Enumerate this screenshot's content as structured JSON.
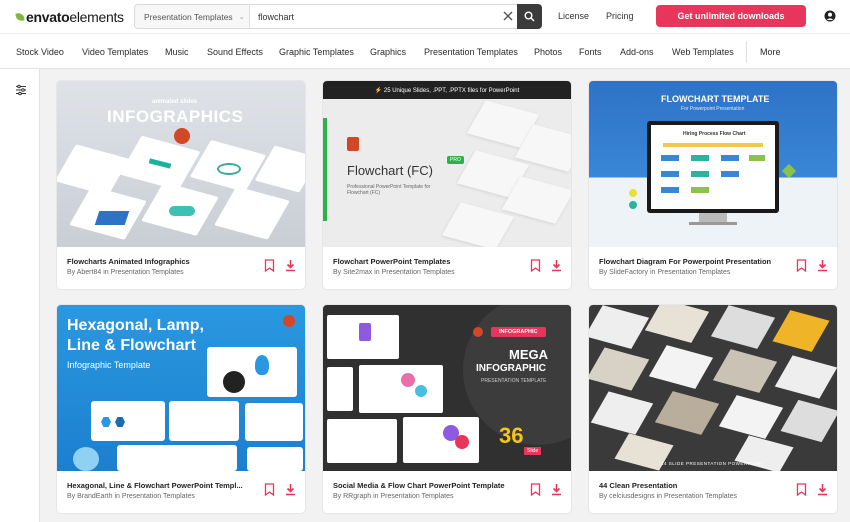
{
  "header": {
    "logo_bold": "envato",
    "logo_light": "elements",
    "search_category": "Presentation Templates",
    "search_value": "flowchart",
    "links": [
      "License",
      "Pricing"
    ],
    "cta": "Get unlimited downloads"
  },
  "nav": {
    "items": [
      "Stock Video",
      "Video Templates",
      "Music",
      "Sound Effects",
      "Graphic Templates",
      "Graphics",
      "Presentation Templates",
      "Photos",
      "Fonts",
      "Add-ons",
      "Web Templates"
    ],
    "more": "More"
  },
  "cards": [
    {
      "title": "Flowcharts Animated Infographics",
      "author": "By Abert84 in Presentation Templates",
      "thumb_top": "animated slides",
      "thumb_main": "INFOGRAPHICS"
    },
    {
      "title": "Flowchart PowerPoint Templates",
      "author": "By Site2max in Presentation Templates",
      "banner": "⚡ 25 Unique Slides, .PPT, .PPTX files for PowerPoint",
      "thumb_main": "Flowchart (FC)",
      "thumb_badge": "PRO",
      "thumb_sub": "Professional PowerPoint Template for Flowchart (FC)"
    },
    {
      "title": "Flowchart Diagram For Powerpoint Presentation",
      "author": "By SlideFactory in Presentation Templates",
      "thumb_main": "FLOWCHART TEMPLATE",
      "thumb_sub": "For Powerpoint Presentation",
      "thumb_screen": "Hiring Process Flow Chart"
    },
    {
      "title": "Hexagonal, Line & Flowchart PowerPoint Templ...",
      "author": "By BrandEarth in Presentation Templates",
      "thumb_l1": "Hexagonal, Lamp,",
      "thumb_l2": "Line & Flowchart",
      "thumb_l3": "Infographic Template"
    },
    {
      "title": "Social Media & Flow Chart PowerPoint Template",
      "author": "By RRgraph in Presentation Templates",
      "thumb_pill": "INFOGRAPHIC",
      "thumb_l1": "MEGA",
      "thumb_l2": "INFOGRAPHIC",
      "thumb_l3": "PRESENTATION TEMPLATE",
      "thumb_num": "36",
      "thumb_num_sub": "Slide"
    },
    {
      "title": "44 Clean Presentation",
      "author": "By celciusdesigns in Presentation Templates",
      "thumb_caption": "44 SLIDE PRESENTATION POWERPOINT"
    }
  ],
  "colors": {
    "accent": "#e8355c",
    "brand_green": "#82b541",
    "download": "#e8355c"
  }
}
